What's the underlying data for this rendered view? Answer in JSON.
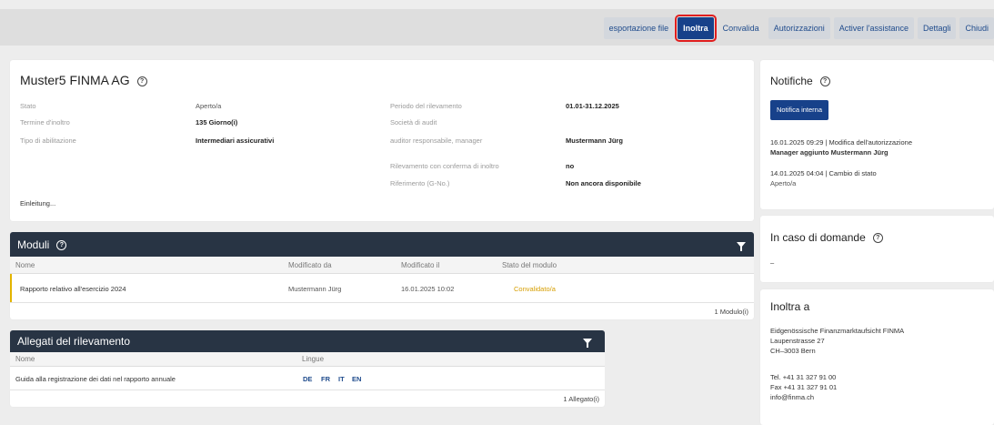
{
  "toolbar": {
    "buttons": [
      "esportazione file",
      "Inoltra",
      "Convalida",
      "Autorizzazioni",
      "Activer l'assistance",
      "Dettagli",
      "Chiudi"
    ]
  },
  "header": {
    "title": "Muster5 FINMA AG",
    "help_glyph": "?",
    "left_fields": [
      {
        "label": "Stato",
        "value": "Aperto/a"
      },
      {
        "label": "Termine d'inoltro",
        "value": "135 Giorno(i)"
      },
      {
        "label": "Tipo di abilitazione",
        "value": "Intermediari assicurativi"
      }
    ],
    "right_fields": [
      {
        "label": "Periodo del rilevamento",
        "value": "01.01-31.12.2025"
      },
      {
        "label": "Società di audit",
        "value": ""
      },
      {
        "label": "auditor responsabile, manager",
        "value": "Mustermann Jürg"
      },
      {
        "label": "Rilevamento con conferma di inoltro",
        "value": "no"
      },
      {
        "label": "Riferimento (G-No.)",
        "value": "Non ancora disponibile"
      }
    ],
    "intro_link": "Einleitung..."
  },
  "moduli": {
    "title": "Moduli",
    "help_glyph": "?",
    "columns": [
      "Nome",
      "Modificato da",
      "Modificato il",
      "Stato del modulo"
    ],
    "rows": [
      {
        "name": "Rapporto relativo all'esercizio 2024",
        "by": "Mustermann Jürg",
        "date": "16.01.2025 10:02",
        "status": "Convalidato/a"
      }
    ],
    "count": "1 Modulo(i)"
  },
  "allegati": {
    "title": "Allegati del rilevamento",
    "columns": [
      "Nome",
      "Lingue"
    ],
    "rows": [
      {
        "name": "Guida alla registrazione dei dati nel rapporto annuale",
        "langs": [
          "DE",
          "FR",
          "IT",
          "EN"
        ]
      }
    ],
    "count": "1 Allegato(i)"
  },
  "notifiche": {
    "title": "Notifiche",
    "help_glyph": "?",
    "button": "Notifica interna",
    "entries": [
      {
        "line1": "16.01.2025 09:29 | Modifica dell'autorizzazione",
        "line2": "Manager aggiunto Mustermann Jürg"
      },
      {
        "line1": "14.01.2025 04:04 | Cambio di stato",
        "line2": "Aperto/a"
      }
    ]
  },
  "domande": {
    "title": "In caso di domande",
    "help_glyph": "?",
    "text": "–"
  },
  "inoltra": {
    "title": "Inoltra a",
    "address": [
      "Eidgenössische Finanzmarktaufsicht FINMA",
      "Laupenstrasse 27",
      "CH–3003 Bern"
    ],
    "contact": [
      "Tel. +41 31 327 91 00",
      "Fax +41 31 327 91 01",
      "info@finma.ch"
    ]
  },
  "colors": {
    "primary": "#17418a",
    "header_bar": "#283444",
    "highlight": "#e01e1e",
    "status_validated": "#d69e00"
  }
}
